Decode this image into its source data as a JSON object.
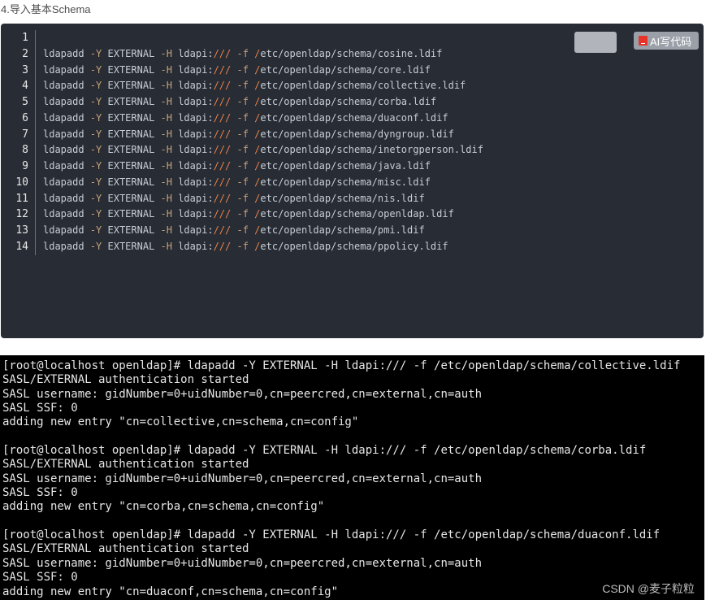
{
  "heading": "4.导入基本Schema",
  "code_block": {
    "line_numbers": [
      "1",
      "2",
      "3",
      "4",
      "5",
      "6",
      "7",
      "8",
      "9",
      "10",
      "11",
      "12",
      "13",
      "14"
    ],
    "lines": [
      "",
      "ldapadd -Y EXTERNAL -H ldapi:/// -f /etc/openldap/schema/cosine.ldif",
      "ldapadd -Y EXTERNAL -H ldapi:/// -f /etc/openldap/schema/core.ldif",
      "ldapadd -Y EXTERNAL -H ldapi:/// -f /etc/openldap/schema/collective.ldif",
      "ldapadd -Y EXTERNAL -H ldapi:/// -f /etc/openldap/schema/corba.ldif",
      "ldapadd -Y EXTERNAL -H ldapi:/// -f /etc/openldap/schema/duaconf.ldif",
      "ldapadd -Y EXTERNAL -H ldapi:/// -f /etc/openldap/schema/dyngroup.ldif",
      "ldapadd -Y EXTERNAL -H ldapi:/// -f /etc/openldap/schema/inetorgperson.ldif",
      "ldapadd -Y EXTERNAL -H ldapi:/// -f /etc/openldap/schema/java.ldif",
      "ldapadd -Y EXTERNAL -H ldapi:/// -f /etc/openldap/schema/misc.ldif",
      "ldapadd -Y EXTERNAL -H ldapi:/// -f /etc/openldap/schema/nis.ldif",
      "ldapadd -Y EXTERNAL -H ldapi:/// -f /etc/openldap/schema/openldap.ldif",
      "ldapadd -Y EXTERNAL -H ldapi:/// -f /etc/openldap/schema/pmi.ldif",
      "ldapadd -Y EXTERNAL -H ldapi:/// -f /etc/openldap/schema/ppolicy.ldif"
    ],
    "ai_button_label": "AI写代码",
    "ai_icon": "ai-logo-icon"
  },
  "terminal": {
    "lines": [
      "[root@localhost openldap]# ldapadd -Y EXTERNAL -H ldapi:/// -f /etc/openldap/schema/collective.ldif",
      "SASL/EXTERNAL authentication started",
      "SASL username: gidNumber=0+uidNumber=0,cn=peercred,cn=external,cn=auth",
      "SASL SSF: 0",
      "adding new entry \"cn=collective,cn=schema,cn=config\"",
      "",
      "[root@localhost openldap]# ldapadd -Y EXTERNAL -H ldapi:/// -f /etc/openldap/schema/corba.ldif",
      "SASL/EXTERNAL authentication started",
      "SASL username: gidNumber=0+uidNumber=0,cn=peercred,cn=external,cn=auth",
      "SASL SSF: 0",
      "adding new entry \"cn=corba,cn=schema,cn=config\"",
      "",
      "[root@localhost openldap]# ldapadd -Y EXTERNAL -H ldapi:/// -f /etc/openldap/schema/duaconf.ldif",
      "SASL/EXTERNAL authentication started",
      "SASL username: gidNumber=0+uidNumber=0,cn=peercred,cn=external,cn=auth",
      "SASL SSF: 0",
      "adding new entry \"cn=duaconf,cn=schema,cn=config\""
    ],
    "watermark": "CSDN @麦子粒粒"
  },
  "colors": {
    "code_bg": "#282c34",
    "flag": "#c5a27a",
    "slash": "#e6824c",
    "terminal_bg": "#000000"
  }
}
